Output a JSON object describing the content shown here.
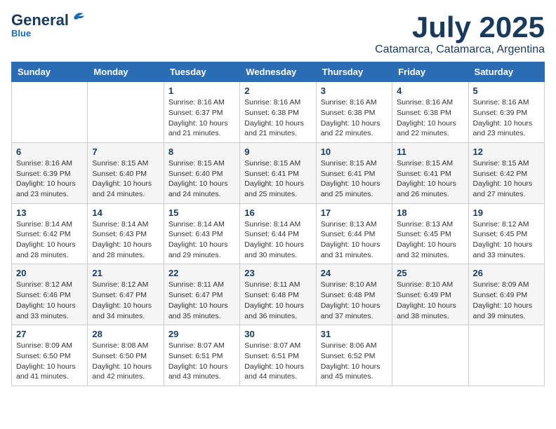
{
  "logo": {
    "general": "General",
    "blue": "Blue",
    "subtitle": "Blue"
  },
  "title": {
    "month_year": "July 2025",
    "location": "Catamarca, Catamarca, Argentina"
  },
  "weekdays": [
    "Sunday",
    "Monday",
    "Tuesday",
    "Wednesday",
    "Thursday",
    "Friday",
    "Saturday"
  ],
  "weeks": [
    [
      {
        "day": "",
        "sunrise": "",
        "sunset": "",
        "daylight": ""
      },
      {
        "day": "",
        "sunrise": "",
        "sunset": "",
        "daylight": ""
      },
      {
        "day": "1",
        "sunrise": "Sunrise: 8:16 AM",
        "sunset": "Sunset: 6:37 PM",
        "daylight": "Daylight: 10 hours and 21 minutes."
      },
      {
        "day": "2",
        "sunrise": "Sunrise: 8:16 AM",
        "sunset": "Sunset: 6:38 PM",
        "daylight": "Daylight: 10 hours and 21 minutes."
      },
      {
        "day": "3",
        "sunrise": "Sunrise: 8:16 AM",
        "sunset": "Sunset: 6:38 PM",
        "daylight": "Daylight: 10 hours and 22 minutes."
      },
      {
        "day": "4",
        "sunrise": "Sunrise: 8:16 AM",
        "sunset": "Sunset: 6:38 PM",
        "daylight": "Daylight: 10 hours and 22 minutes."
      },
      {
        "day": "5",
        "sunrise": "Sunrise: 8:16 AM",
        "sunset": "Sunset: 6:39 PM",
        "daylight": "Daylight: 10 hours and 23 minutes."
      }
    ],
    [
      {
        "day": "6",
        "sunrise": "Sunrise: 8:16 AM",
        "sunset": "Sunset: 6:39 PM",
        "daylight": "Daylight: 10 hours and 23 minutes."
      },
      {
        "day": "7",
        "sunrise": "Sunrise: 8:15 AM",
        "sunset": "Sunset: 6:40 PM",
        "daylight": "Daylight: 10 hours and 24 minutes."
      },
      {
        "day": "8",
        "sunrise": "Sunrise: 8:15 AM",
        "sunset": "Sunset: 6:40 PM",
        "daylight": "Daylight: 10 hours and 24 minutes."
      },
      {
        "day": "9",
        "sunrise": "Sunrise: 8:15 AM",
        "sunset": "Sunset: 6:41 PM",
        "daylight": "Daylight: 10 hours and 25 minutes."
      },
      {
        "day": "10",
        "sunrise": "Sunrise: 8:15 AM",
        "sunset": "Sunset: 6:41 PM",
        "daylight": "Daylight: 10 hours and 25 minutes."
      },
      {
        "day": "11",
        "sunrise": "Sunrise: 8:15 AM",
        "sunset": "Sunset: 6:41 PM",
        "daylight": "Daylight: 10 hours and 26 minutes."
      },
      {
        "day": "12",
        "sunrise": "Sunrise: 8:15 AM",
        "sunset": "Sunset: 6:42 PM",
        "daylight": "Daylight: 10 hours and 27 minutes."
      }
    ],
    [
      {
        "day": "13",
        "sunrise": "Sunrise: 8:14 AM",
        "sunset": "Sunset: 6:42 PM",
        "daylight": "Daylight: 10 hours and 28 minutes."
      },
      {
        "day": "14",
        "sunrise": "Sunrise: 8:14 AM",
        "sunset": "Sunset: 6:43 PM",
        "daylight": "Daylight: 10 hours and 28 minutes."
      },
      {
        "day": "15",
        "sunrise": "Sunrise: 8:14 AM",
        "sunset": "Sunset: 6:43 PM",
        "daylight": "Daylight: 10 hours and 29 minutes."
      },
      {
        "day": "16",
        "sunrise": "Sunrise: 8:14 AM",
        "sunset": "Sunset: 6:44 PM",
        "daylight": "Daylight: 10 hours and 30 minutes."
      },
      {
        "day": "17",
        "sunrise": "Sunrise: 8:13 AM",
        "sunset": "Sunset: 6:44 PM",
        "daylight": "Daylight: 10 hours and 31 minutes."
      },
      {
        "day": "18",
        "sunrise": "Sunrise: 8:13 AM",
        "sunset": "Sunset: 6:45 PM",
        "daylight": "Daylight: 10 hours and 32 minutes."
      },
      {
        "day": "19",
        "sunrise": "Sunrise: 8:12 AM",
        "sunset": "Sunset: 6:45 PM",
        "daylight": "Daylight: 10 hours and 33 minutes."
      }
    ],
    [
      {
        "day": "20",
        "sunrise": "Sunrise: 8:12 AM",
        "sunset": "Sunset: 6:46 PM",
        "daylight": "Daylight: 10 hours and 33 minutes."
      },
      {
        "day": "21",
        "sunrise": "Sunrise: 8:12 AM",
        "sunset": "Sunset: 6:47 PM",
        "daylight": "Daylight: 10 hours and 34 minutes."
      },
      {
        "day": "22",
        "sunrise": "Sunrise: 8:11 AM",
        "sunset": "Sunset: 6:47 PM",
        "daylight": "Daylight: 10 hours and 35 minutes."
      },
      {
        "day": "23",
        "sunrise": "Sunrise: 8:11 AM",
        "sunset": "Sunset: 6:48 PM",
        "daylight": "Daylight: 10 hours and 36 minutes."
      },
      {
        "day": "24",
        "sunrise": "Sunrise: 8:10 AM",
        "sunset": "Sunset: 6:48 PM",
        "daylight": "Daylight: 10 hours and 37 minutes."
      },
      {
        "day": "25",
        "sunrise": "Sunrise: 8:10 AM",
        "sunset": "Sunset: 6:49 PM",
        "daylight": "Daylight: 10 hours and 38 minutes."
      },
      {
        "day": "26",
        "sunrise": "Sunrise: 8:09 AM",
        "sunset": "Sunset: 6:49 PM",
        "daylight": "Daylight: 10 hours and 39 minutes."
      }
    ],
    [
      {
        "day": "27",
        "sunrise": "Sunrise: 8:09 AM",
        "sunset": "Sunset: 6:50 PM",
        "daylight": "Daylight: 10 hours and 41 minutes."
      },
      {
        "day": "28",
        "sunrise": "Sunrise: 8:08 AM",
        "sunset": "Sunset: 6:50 PM",
        "daylight": "Daylight: 10 hours and 42 minutes."
      },
      {
        "day": "29",
        "sunrise": "Sunrise: 8:07 AM",
        "sunset": "Sunset: 6:51 PM",
        "daylight": "Daylight: 10 hours and 43 minutes."
      },
      {
        "day": "30",
        "sunrise": "Sunrise: 8:07 AM",
        "sunset": "Sunset: 6:51 PM",
        "daylight": "Daylight: 10 hours and 44 minutes."
      },
      {
        "day": "31",
        "sunrise": "Sunrise: 8:06 AM",
        "sunset": "Sunset: 6:52 PM",
        "daylight": "Daylight: 10 hours and 45 minutes."
      },
      {
        "day": "",
        "sunrise": "",
        "sunset": "",
        "daylight": ""
      },
      {
        "day": "",
        "sunrise": "",
        "sunset": "",
        "daylight": ""
      }
    ]
  ]
}
